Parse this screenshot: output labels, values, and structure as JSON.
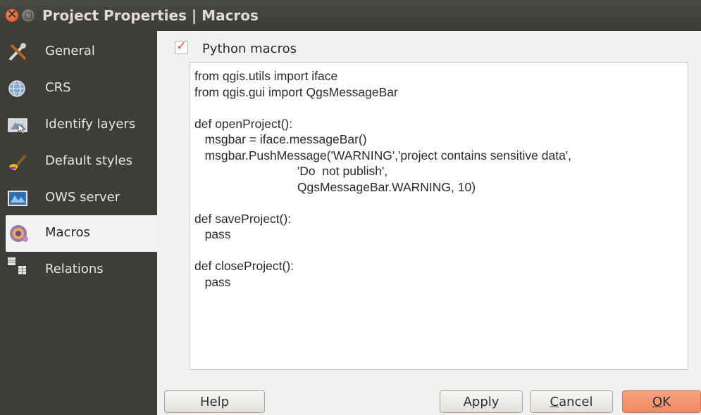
{
  "window": {
    "title": "Project Properties | Macros"
  },
  "sidebar": {
    "items": [
      {
        "label": "General",
        "icon": "tools-icon"
      },
      {
        "label": "CRS",
        "icon": "globe-icon"
      },
      {
        "label": "Identify layers",
        "icon": "identify-layers-icon"
      },
      {
        "label": "Default styles",
        "icon": "paint-brush-icon"
      },
      {
        "label": "OWS server",
        "icon": "map-server-icon"
      },
      {
        "label": "Macros",
        "icon": "gear-icon",
        "selected": true
      },
      {
        "label": "Relations",
        "icon": "table-relations-icon"
      }
    ]
  },
  "macros": {
    "checkbox_label": "Python macros",
    "checked": true,
    "code": "from qgis.utils import iface\nfrom qgis.gui import QgsMessageBar\n\ndef openProject():\n   msgbar = iface.messageBar()\n   msgbar.PushMessage('WARNING','project contains sensitive data',\n                              'Do  not publish',\n                              QgsMessageBar.WARNING, 10)\n\ndef saveProject():\n   pass\n\ndef closeProject():\n   pass"
  },
  "buttons": {
    "help": "Help",
    "apply": "Apply",
    "cancel_rest": "ancel",
    "cancel_mnemonic": "C",
    "ok_mnemonic": "O",
    "ok_rest": "K"
  },
  "colors": {
    "accent": "#ee8a63",
    "titlebar": "#3c3b37",
    "sidebar": "#3e3d39"
  }
}
